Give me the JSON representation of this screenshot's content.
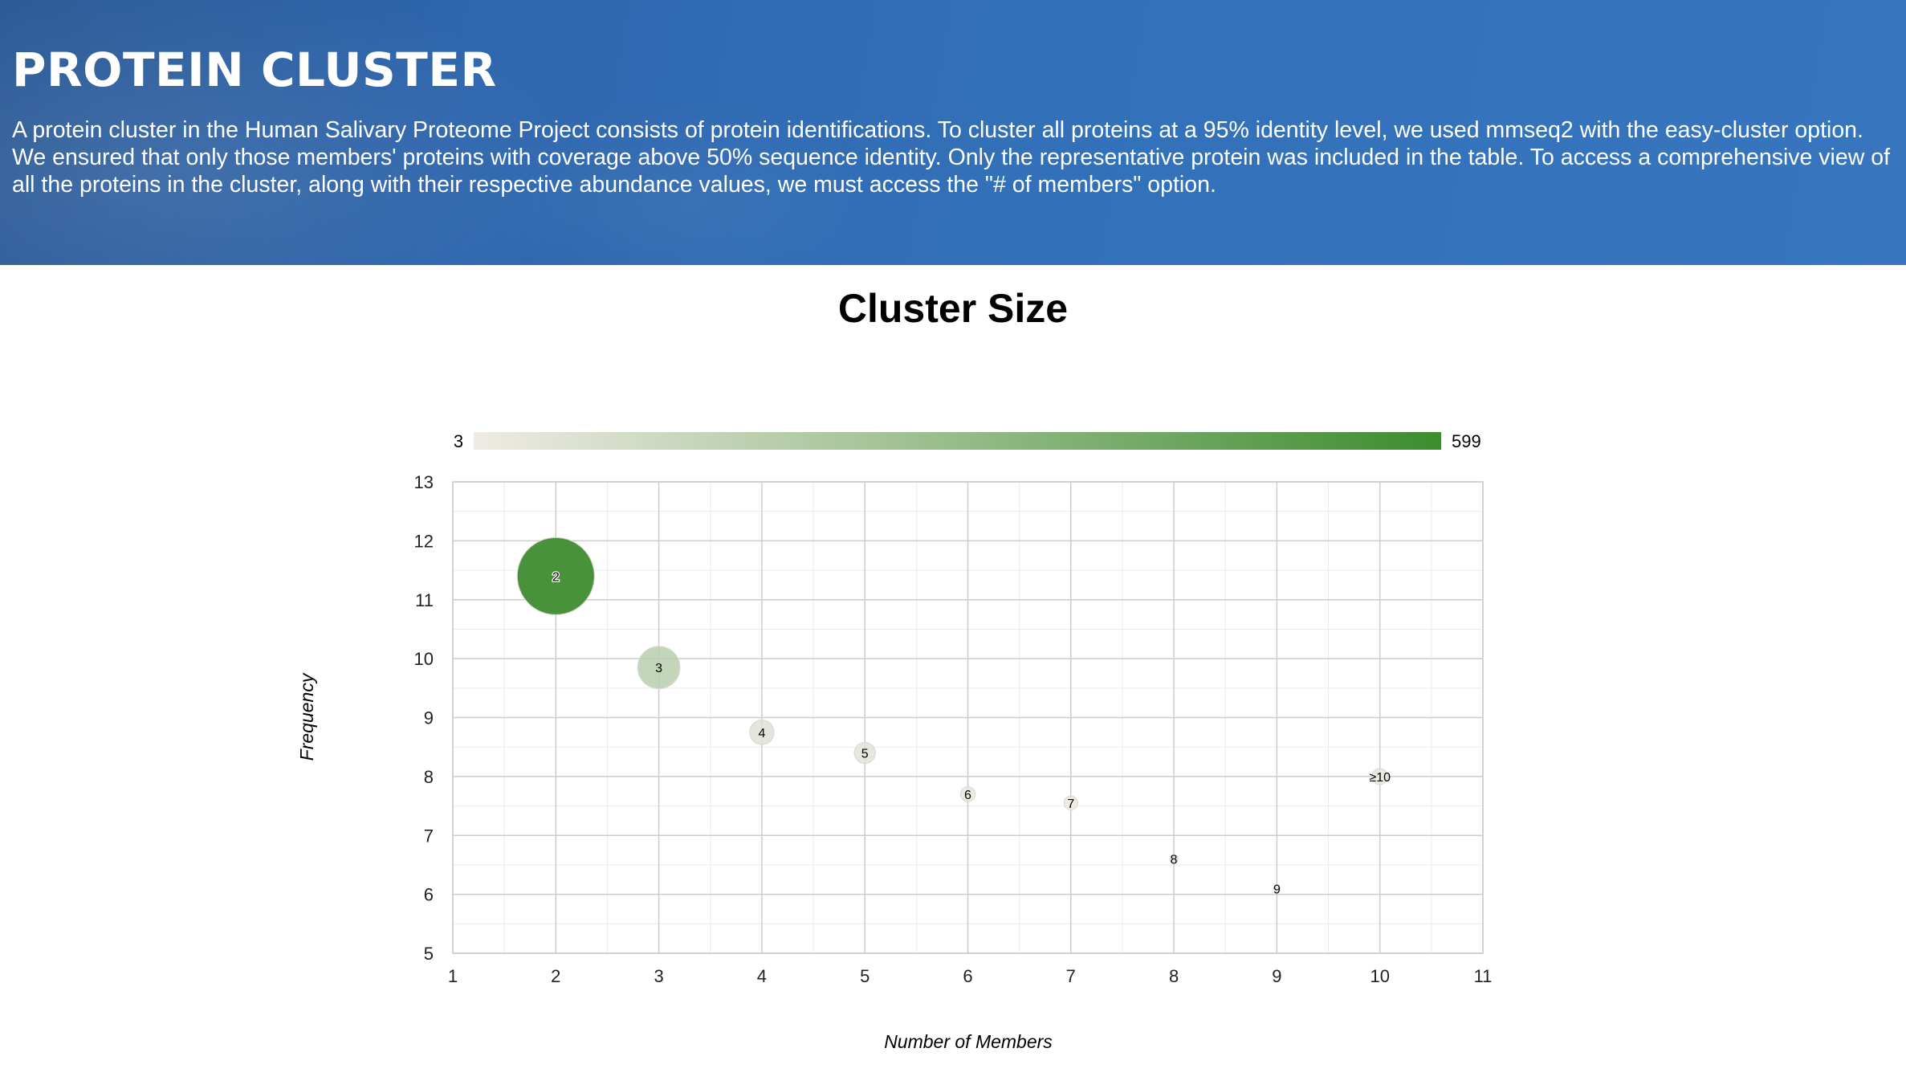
{
  "header": {
    "title": "PROTEIN CLUSTER",
    "description": "A protein cluster in the Human Salivary Proteome Project consists of protein identifications. To cluster all proteins at a 95% identity level, we used mmseq2 with the easy-cluster option. We ensured that only those members' proteins with coverage above 50% sequence identity. Only the representative protein was included in the table. To access a comprehensive view of all the proteins in the cluster, along with their respective abundance values, we must access the \"# of members\" option."
  },
  "colors": {
    "banner": "#3271b9",
    "scale_low": "#efebe4",
    "scale_high": "#3d8c2f"
  },
  "chart_data": {
    "type": "scatter",
    "subtype": "bubble",
    "title": "Cluster Size",
    "xlabel": "Number of Members",
    "ylabel": "Frequency",
    "xlim": [
      1,
      11
    ],
    "ylim": [
      5,
      13
    ],
    "xticks": [
      1,
      2,
      3,
      4,
      5,
      6,
      7,
      8,
      9,
      10,
      11
    ],
    "yticks": [
      5,
      6,
      7,
      8,
      9,
      10,
      11,
      12,
      13
    ],
    "grid": true,
    "colorscale": {
      "min": 3,
      "max": 599,
      "min_label": "3",
      "max_label": "599"
    },
    "points": [
      {
        "label": "2",
        "x": 2,
        "y": 11.4,
        "color_value": 599
      },
      {
        "label": "3",
        "x": 3,
        "y": 9.85,
        "color_value": 180
      },
      {
        "label": "4",
        "x": 4,
        "y": 8.75,
        "color_value": 60
      },
      {
        "label": "5",
        "x": 5,
        "y": 8.4,
        "color_value": 45
      },
      {
        "label": "6",
        "x": 6,
        "y": 7.7,
        "color_value": 22
      },
      {
        "label": "7",
        "x": 7,
        "y": 7.55,
        "color_value": 19
      },
      {
        "label": "8",
        "x": 8,
        "y": 6.6,
        "color_value": 7
      },
      {
        "label": "9",
        "x": 9,
        "y": 6.1,
        "color_value": 3
      },
      {
        "label": "≥10",
        "x": 10,
        "y": 8.0,
        "color_value": 26
      }
    ]
  }
}
